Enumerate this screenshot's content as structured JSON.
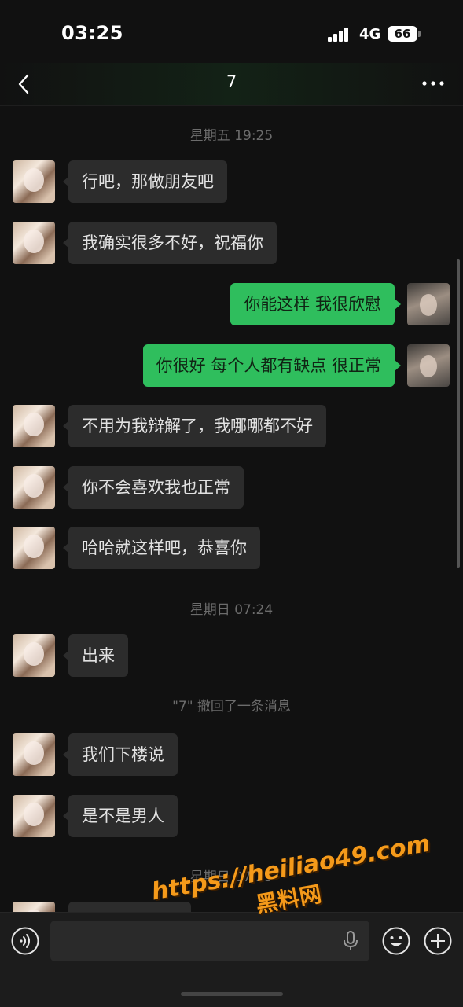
{
  "status_bar": {
    "time": "03:25",
    "network": "4G",
    "battery": "66"
  },
  "nav": {
    "title": "7",
    "back_icon": "chevron-left-icon",
    "more_icon": "more-dots-icon"
  },
  "chat": {
    "timestamps": [
      "星期五 19:25",
      "星期日 07:24",
      "星期日 07:25"
    ],
    "system_notice": "\"7\" 撤回了一条消息",
    "messages": [
      {
        "side": "left",
        "text": "行吧，那做朋友吧"
      },
      {
        "side": "left",
        "text": "我确实很多不好，祝福你"
      },
      {
        "side": "right",
        "text": "你能这样 我很欣慰"
      },
      {
        "side": "right",
        "text": "你很好 每个人都有缺点 很正常"
      },
      {
        "side": "left",
        "text": "不用为我辩解了，我哪哪都不好"
      },
      {
        "side": "left",
        "text": "你不会喜欢我也正常"
      },
      {
        "side": "left",
        "text": "哈哈就这样吧，恭喜你"
      },
      {
        "side": "left",
        "text": "出来"
      },
      {
        "side": "left",
        "text": "我们下楼说"
      },
      {
        "side": "left",
        "text": "是不是男人"
      },
      {
        "side": "left",
        "text": ""
      }
    ]
  },
  "input_bar": {
    "voice_icon": "voice-icon",
    "mic_icon": "mic-icon",
    "emoji_icon": "emoji-icon",
    "plus_icon": "plus-icon",
    "input_value": ""
  },
  "watermark": {
    "url": "https://heiliao49.com",
    "name": "黑料网"
  },
  "colors": {
    "background": "#111111",
    "bubble_left": "#2c2c2c",
    "bubble_right": "#2fbe5d",
    "watermark": "#f59a1a"
  }
}
